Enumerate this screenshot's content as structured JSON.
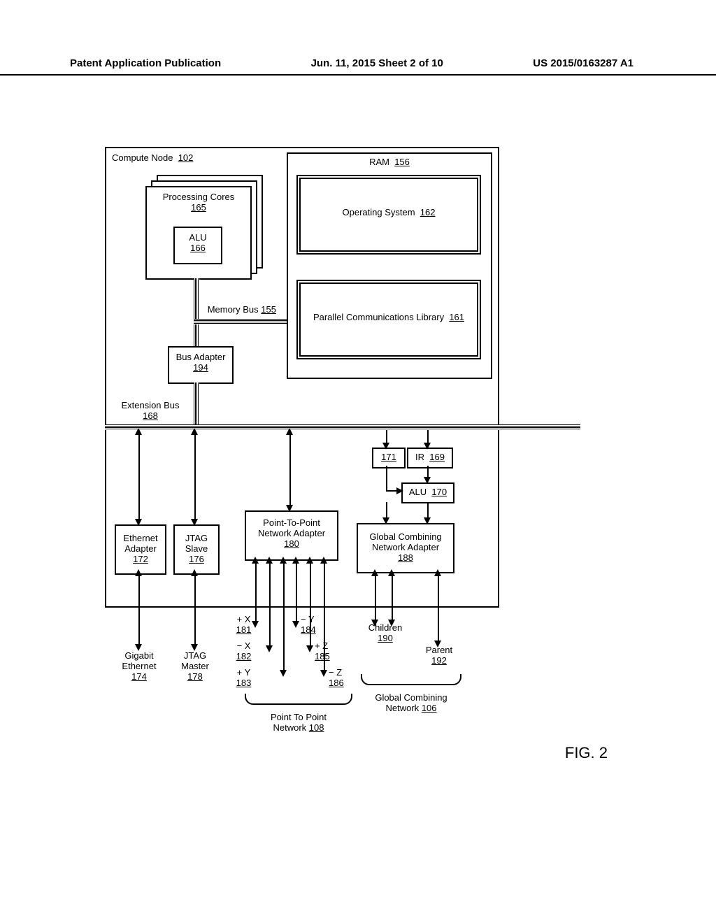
{
  "header": {
    "left": "Patent Application Publication",
    "center": "Jun. 11, 2015  Sheet 2 of 10",
    "right": "US 2015/0163287 A1"
  },
  "fig": "FIG. 2",
  "compute_node": {
    "label": "Compute Node",
    "ref": "102"
  },
  "cores": {
    "label": "Processing Cores",
    "ref": "165"
  },
  "alu_core": {
    "label": "ALU",
    "ref": "166"
  },
  "ram": {
    "label": "RAM",
    "ref": "156"
  },
  "os": {
    "label": "Operating System",
    "ref": "162"
  },
  "pcl": {
    "label": "Parallel Communications Library",
    "ref": "161"
  },
  "memory_bus": {
    "label": "Memory Bus",
    "ref": "155"
  },
  "bus_adapter": {
    "label": "Bus Adapter",
    "ref": "194"
  },
  "extension_bus": {
    "label": "Extension Bus",
    "ref": "168"
  },
  "reg171": {
    "ref": "171"
  },
  "ir": {
    "label": "IR",
    "ref": "169"
  },
  "alu2": {
    "label": "ALU",
    "ref": "170"
  },
  "eth_adapter": {
    "label": "Ethernet Adapter",
    "ref": "172"
  },
  "jtag_slave": {
    "label": "JTAG Slave",
    "ref": "176"
  },
  "p2p_adapter": {
    "label": "Point-To-Point Network Adapter",
    "ref": "180"
  },
  "gcn_adapter": {
    "label": "Global Combining Network Adapter",
    "ref": "188"
  },
  "gig_eth": {
    "label": "Gigabit Ethernet",
    "ref": "174"
  },
  "jtag_master": {
    "label": "JTAG Master",
    "ref": "178"
  },
  "xp": {
    "label": "+ X",
    "ref": "181"
  },
  "xm": {
    "label": "− X",
    "ref": "182"
  },
  "yp": {
    "label": "+ Y",
    "ref": "183"
  },
  "ym": {
    "label": "− Y",
    "ref": "184"
  },
  "zp": {
    "label": "+ Z",
    "ref": "185"
  },
  "zm": {
    "label": "− Z",
    "ref": "186"
  },
  "children": {
    "label": "Children",
    "ref": "190"
  },
  "parent": {
    "label": "Parent",
    "ref": "192"
  },
  "p2p_net": {
    "label": "Point To Point Network",
    "ref": "108"
  },
  "gcn_net": {
    "label": "Global Combining Network",
    "ref": "106"
  }
}
